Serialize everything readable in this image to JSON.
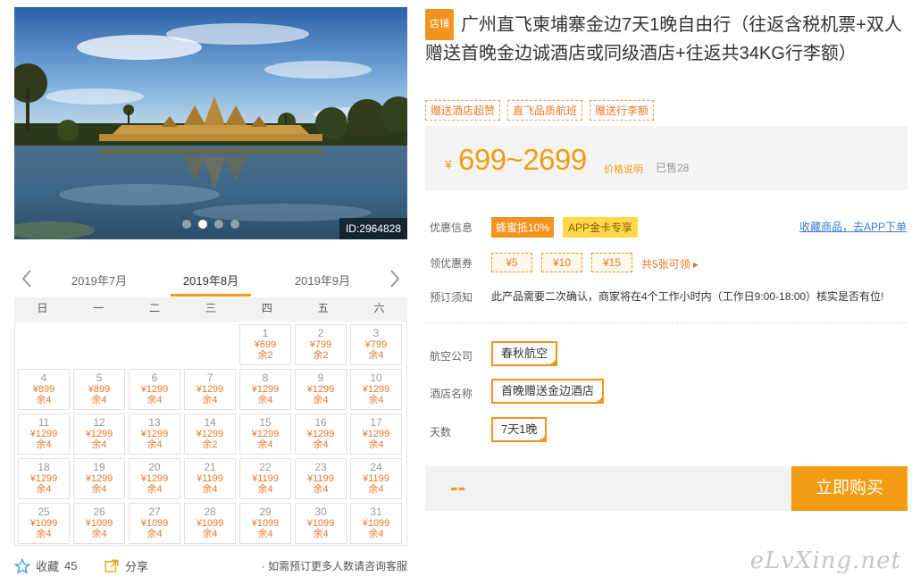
{
  "hero": {
    "image_id": "ID:2964828",
    "dot_count": 4,
    "active_dot": 1
  },
  "calendar": {
    "prev_month": "2019年7月",
    "current_month": "2019年8月",
    "next_month": "2019年9月",
    "weekdays": [
      "日",
      "一",
      "二",
      "三",
      "四",
      "五",
      "六"
    ],
    "first_weekday_index": 4,
    "days": [
      {
        "day": "1",
        "price": "¥699",
        "remain": "余2"
      },
      {
        "day": "2",
        "price": "¥799",
        "remain": "余2"
      },
      {
        "day": "3",
        "price": "¥799",
        "remain": "余4"
      },
      {
        "day": "4",
        "price": "¥899",
        "remain": "余4"
      },
      {
        "day": "5",
        "price": "¥899",
        "remain": "余4"
      },
      {
        "day": "6",
        "price": "¥1299",
        "remain": "余4"
      },
      {
        "day": "7",
        "price": "¥1299",
        "remain": "余4"
      },
      {
        "day": "8",
        "price": "¥1299",
        "remain": "余4"
      },
      {
        "day": "9",
        "price": "¥1299",
        "remain": "余4"
      },
      {
        "day": "10",
        "price": "¥1299",
        "remain": "余4"
      },
      {
        "day": "11",
        "price": "¥1299",
        "remain": "余4"
      },
      {
        "day": "12",
        "price": "¥1299",
        "remain": "余4"
      },
      {
        "day": "13",
        "price": "¥1299",
        "remain": "余4"
      },
      {
        "day": "14",
        "price": "¥1299",
        "remain": "余2"
      },
      {
        "day": "15",
        "price": "¥1299",
        "remain": "余4"
      },
      {
        "day": "16",
        "price": "¥1299",
        "remain": "余4"
      },
      {
        "day": "17",
        "price": "¥1299",
        "remain": "余4"
      },
      {
        "day": "18",
        "price": "¥1299",
        "remain": "余4"
      },
      {
        "day": "19",
        "price": "¥1299",
        "remain": "余4"
      },
      {
        "day": "20",
        "price": "¥1299",
        "remain": "余4"
      },
      {
        "day": "21",
        "price": "¥1199",
        "remain": "余4"
      },
      {
        "day": "22",
        "price": "¥1199",
        "remain": "余4"
      },
      {
        "day": "23",
        "price": "¥1199",
        "remain": "余4"
      },
      {
        "day": "24",
        "price": "¥1199",
        "remain": "余4"
      },
      {
        "day": "25",
        "price": "¥1099",
        "remain": "余4"
      },
      {
        "day": "26",
        "price": "¥1099",
        "remain": "余4"
      },
      {
        "day": "27",
        "price": "¥1099",
        "remain": "余4"
      },
      {
        "day": "28",
        "price": "¥1099",
        "remain": "余4"
      },
      {
        "day": "29",
        "price": "¥1099",
        "remain": "余4"
      },
      {
        "day": "30",
        "price": "¥1099",
        "remain": "余4"
      },
      {
        "day": "31",
        "price": "¥1099",
        "remain": "余4"
      }
    ]
  },
  "bottom": {
    "fav_label": "收藏",
    "fav_count": "45",
    "share_label": "分享",
    "consult_text": "· 如需预订更多人数请咨询客服"
  },
  "product": {
    "shop_tag": "店铺",
    "title": "广州直飞柬埔寨金边7天1晚自由行（往返含税机票+双人赠送首晚金边诚酒店或同级酒店+往返共34KG行李额）",
    "tags": [
      "赠送酒店超赞",
      "直飞品质航班",
      "赠送行李额"
    ]
  },
  "price": {
    "currency": "¥",
    "range": "699~2699",
    "explain": "价格说明",
    "sold": "已售28"
  },
  "promo": {
    "label": "优惠信息",
    "badge_honey": "蜂蜜抵10%",
    "badge_app": "APP金卡专享",
    "fav_link": "收藏商品，去APP下单"
  },
  "coupons": {
    "label": "领优惠券",
    "items": [
      "¥5",
      "¥10",
      "¥15"
    ],
    "more": "共5张可领 ▸"
  },
  "notice": {
    "label": "预订须知",
    "text": "此产品需要二次确认，商家将在4个工作小时内（工作日9:00-18:00）核实是否有位!"
  },
  "options": {
    "airline_label": "航空公司",
    "airline_value": "春秋航空",
    "hotel_label": "酒店名称",
    "hotel_value": "首晚赠送金边酒店",
    "days_label": "天数",
    "days_value": "7天1晚"
  },
  "buy": {
    "price_placeholder": "--",
    "button": "立即购买"
  },
  "watermark": "eLvXing.net",
  "colors": {
    "accent": "#f39c12",
    "link": "#3a7bd5",
    "honey_badge": "#f0931f",
    "app_badge": "#fcd94a"
  }
}
